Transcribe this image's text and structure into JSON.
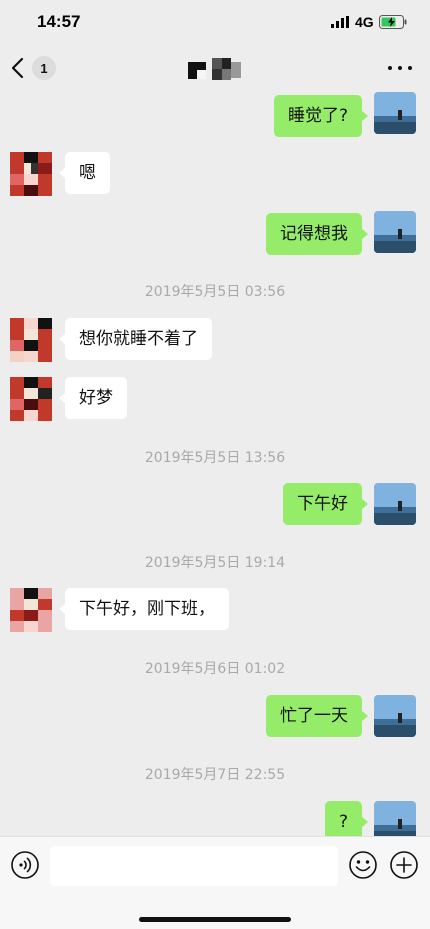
{
  "status_bar": {
    "time": "14:57",
    "network": "4G",
    "icons": [
      "signal-icon",
      "battery-charging-icon"
    ]
  },
  "nav": {
    "unread_count": "1",
    "icons": [
      "back-chevron-icon",
      "more-dots-icon"
    ]
  },
  "messages": [
    {
      "side": "out",
      "text": "睡觉了?"
    },
    {
      "side": "in",
      "text": "嗯"
    },
    {
      "side": "out",
      "text": "记得想我"
    },
    {
      "type": "time",
      "text": "2019年5月5日 03:56"
    },
    {
      "side": "in",
      "text": "想你就睡不着了"
    },
    {
      "side": "in",
      "text": "好梦"
    },
    {
      "type": "time",
      "text": "2019年5月5日 13:56"
    },
    {
      "side": "out",
      "text": "下午好"
    },
    {
      "type": "time",
      "text": "2019年5月5日 19:14"
    },
    {
      "side": "in",
      "text": "下午好，刚下班，"
    },
    {
      "type": "time",
      "text": "2019年5月6日 01:02"
    },
    {
      "side": "out",
      "text": "忙了一天"
    },
    {
      "type": "time",
      "text": "2019年5月7日 22:55"
    },
    {
      "side": "out",
      "text": "?"
    }
  ],
  "input_bar": {
    "placeholder": "",
    "icons": [
      "voice-icon",
      "emoji-icon",
      "plus-icon"
    ]
  },
  "colors": {
    "background": "#ededed",
    "outgoing_bubble": "#95ec69",
    "incoming_bubble": "#ffffff",
    "timestamp_text": "#a9a9a9"
  }
}
